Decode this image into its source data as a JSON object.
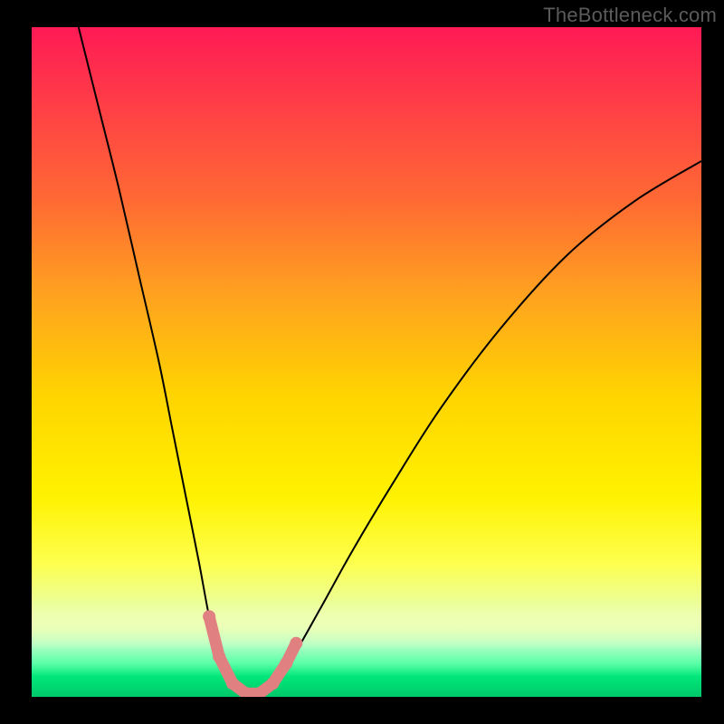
{
  "watermark": "TheBottleneck.com",
  "chart_data": {
    "type": "line",
    "title": "",
    "xlabel": "",
    "ylabel": "",
    "xlim": [
      0,
      100
    ],
    "ylim": [
      0,
      100
    ],
    "grid": false,
    "legend": false,
    "gradient_stops": [
      {
        "pos": 0.0,
        "color": "#ff1a55"
      },
      {
        "pos": 0.12,
        "color": "#ff3f46"
      },
      {
        "pos": 0.26,
        "color": "#ff6a33"
      },
      {
        "pos": 0.4,
        "color": "#ffa21f"
      },
      {
        "pos": 0.55,
        "color": "#ffd400"
      },
      {
        "pos": 0.7,
        "color": "#fff200"
      },
      {
        "pos": 0.8,
        "color": "#fdff4e"
      },
      {
        "pos": 0.88,
        "color": "#e6ffb0"
      },
      {
        "pos": 0.92,
        "color": "#b7ffc8"
      },
      {
        "pos": 0.95,
        "color": "#5cffa8"
      },
      {
        "pos": 0.97,
        "color": "#00e67a"
      },
      {
        "pos": 1.0,
        "color": "#00c86a"
      }
    ],
    "series": [
      {
        "name": "bottleneck-curve",
        "x": [
          7,
          10,
          13,
          16,
          19,
          21,
          23,
          25,
          26.5,
          28,
          30,
          32,
          34,
          36,
          39,
          43,
          48,
          54,
          61,
          70,
          80,
          90,
          100
        ],
        "values": [
          100,
          88,
          76,
          63,
          50,
          40,
          30,
          20,
          12,
          6,
          2,
          0.5,
          0.5,
          2,
          6,
          13,
          22,
          32,
          43,
          55,
          66,
          74,
          80
        ]
      }
    ],
    "markers": {
      "name": "bottom-points",
      "color": "#e08080",
      "points": [
        {
          "x": 26.5,
          "y": 12
        },
        {
          "x": 28.0,
          "y": 6
        },
        {
          "x": 30.0,
          "y": 2
        },
        {
          "x": 32.0,
          "y": 0.5
        },
        {
          "x": 34.0,
          "y": 0.5
        },
        {
          "x": 36.0,
          "y": 2
        },
        {
          "x": 38.0,
          "y": 5
        },
        {
          "x": 39.5,
          "y": 8
        }
      ]
    }
  }
}
